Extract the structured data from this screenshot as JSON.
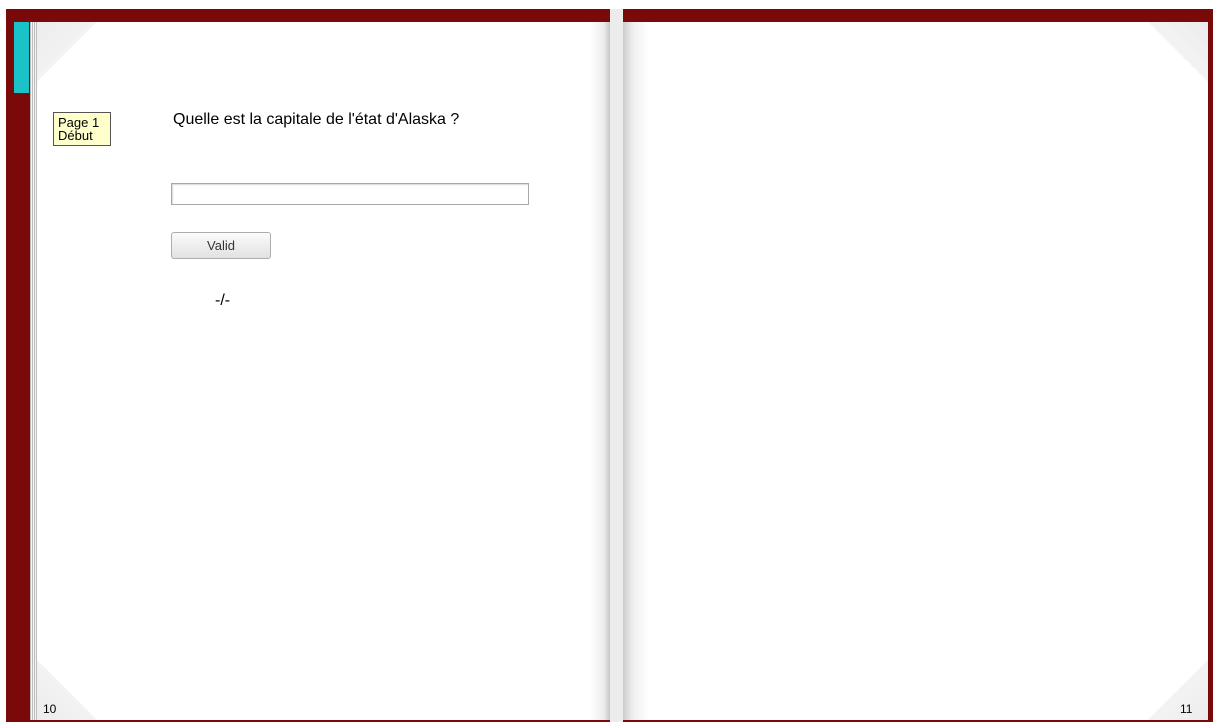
{
  "book": {
    "left_page": {
      "tag_line1": "Page 1",
      "tag_line2": "Début",
      "question": "Quelle est la capitale de l'état d'Alaska ?",
      "answer_value": "",
      "valid_label": "Valid",
      "result": "-/-",
      "page_number": "10"
    },
    "right_page": {
      "page_number": "11"
    }
  },
  "colors": {
    "cover": "#7a0a0a",
    "bookmark": "#19c3c8",
    "tag_background": "#ffffcc"
  }
}
